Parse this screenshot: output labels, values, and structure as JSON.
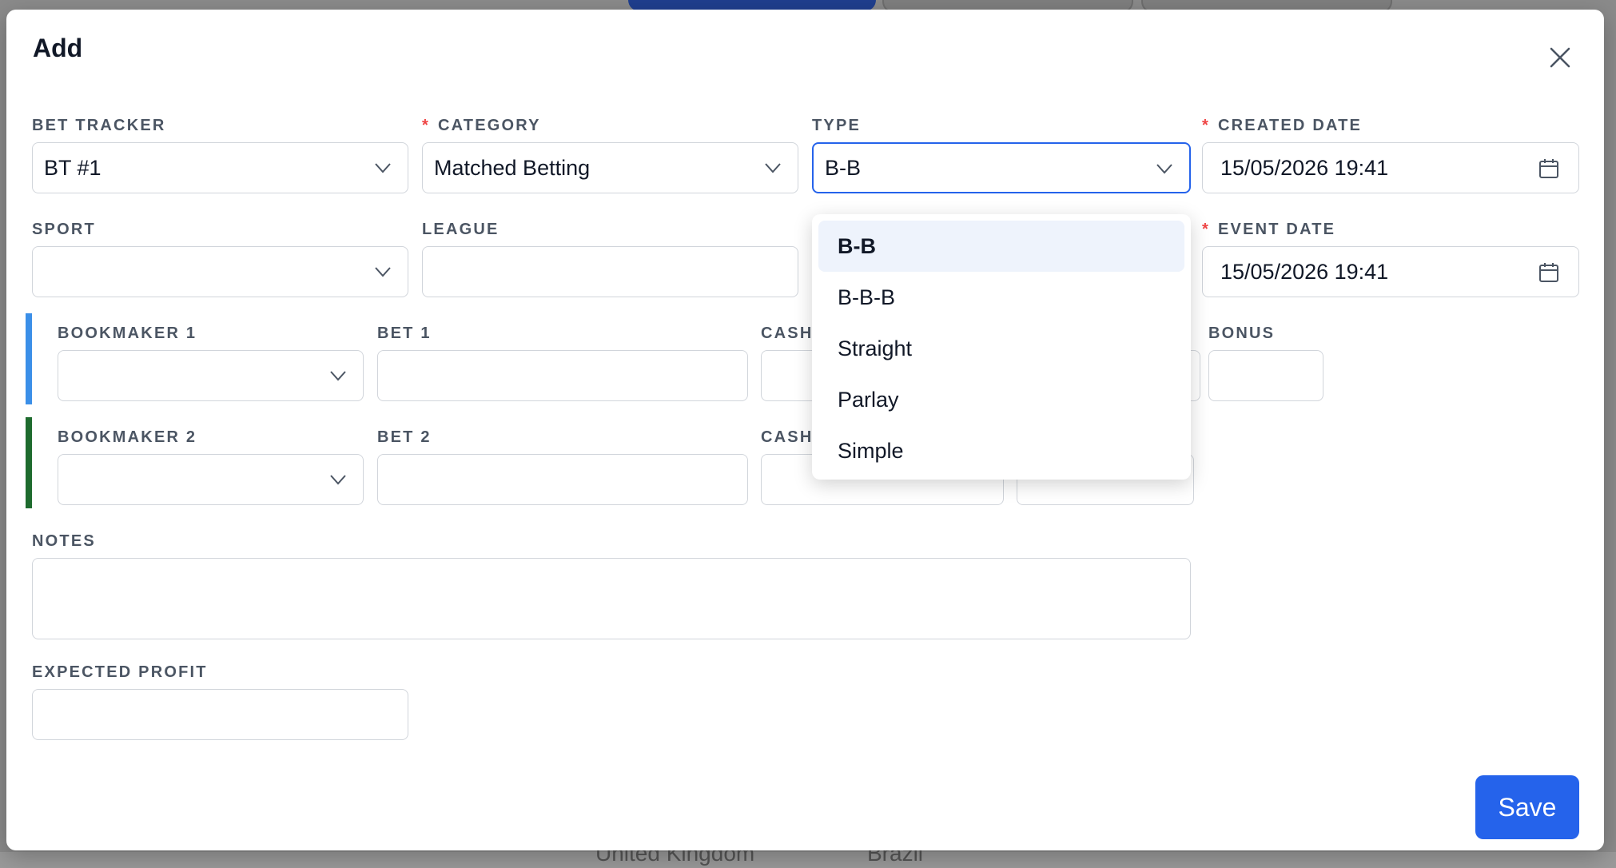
{
  "background": {
    "country_1": "United Kingdom",
    "country_2": "Brazil"
  },
  "modal": {
    "title": "Add",
    "save_label": "Save"
  },
  "fields": {
    "bet_tracker": {
      "label": "BET TRACKER",
      "value": "BT #1"
    },
    "category": {
      "label": "CATEGORY",
      "value": "Matched Betting",
      "required_mark": "*"
    },
    "type": {
      "label": "TYPE",
      "value": "B-B"
    },
    "created_date": {
      "label": "CREATED DATE",
      "value": "15/05/2026 19:41",
      "required_mark": "*"
    },
    "sport": {
      "label": "SPORT",
      "value": ""
    },
    "league": {
      "label": "LEAGUE",
      "value": ""
    },
    "event_date": {
      "label": "EVENT DATE",
      "value": "15/05/2026 19:41",
      "required_mark": "*"
    },
    "bookmaker_1": {
      "label": "BOOKMAKER 1",
      "value": ""
    },
    "bet_1": {
      "label": "BET 1",
      "value": ""
    },
    "cash_1": {
      "label": "CASH",
      "value": ""
    },
    "bonus_1": {
      "label": "BONUS",
      "value": ""
    },
    "bookmaker_2": {
      "label": "BOOKMAKER 2",
      "value": ""
    },
    "bet_2": {
      "label": "BET 2",
      "value": ""
    },
    "cash_2": {
      "label": "CASH",
      "value": ""
    },
    "notes": {
      "label": "NOTES",
      "value": ""
    },
    "expected_profit": {
      "label": "EXPECTED PROFIT",
      "value": ""
    }
  },
  "type_dropdown": {
    "options": [
      "B-B",
      "B-B-B",
      "Straight",
      "Parlay",
      "Simple"
    ],
    "selected": "B-B"
  },
  "colors": {
    "primary": "#2563eb",
    "bookmaker_1_stripe": "#3b8fe8",
    "bookmaker_2_stripe": "#1e6b2e",
    "required": "#ef4444"
  }
}
